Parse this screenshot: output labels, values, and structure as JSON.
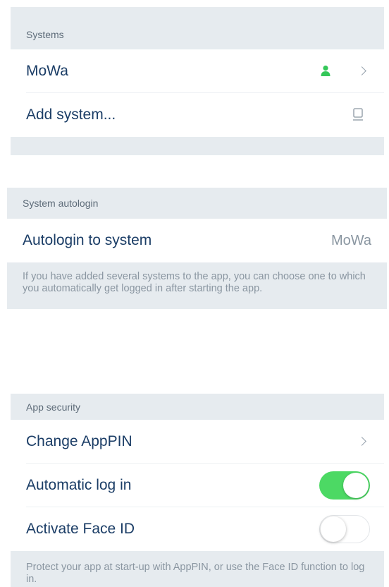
{
  "systems": {
    "header": "Systems",
    "items": [
      {
        "label": "MoWa",
        "icon": "user-icon",
        "icon_color": "#34c759"
      },
      {
        "label": "Add system...",
        "icon": "qr-scanner-icon"
      }
    ]
  },
  "autologin": {
    "header": "System autologin",
    "label": "Autologin to system",
    "value": "MoWa",
    "footer": "If you have added several systems to the app, you can choose one to which you automatically get logged in after starting the app."
  },
  "app_security": {
    "header": "App security",
    "change_pin_label": "Change AppPIN",
    "auto_login_label": "Automatic log in",
    "auto_login_enabled": true,
    "face_id_label": "Activate Face ID",
    "face_id_enabled": false,
    "footer": "Protect your app at start-up with AppPIN, or use the Face ID function to log in."
  },
  "colors": {
    "accent_green": "#4cd964",
    "section_bg": "#e6ebef",
    "label_text": "#1b3d66"
  }
}
